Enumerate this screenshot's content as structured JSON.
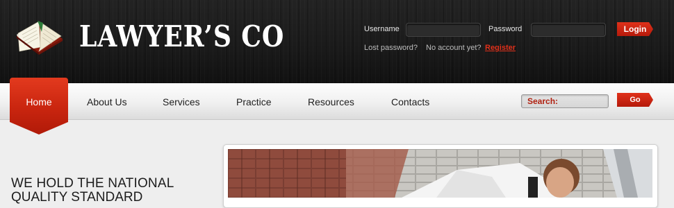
{
  "brand": {
    "name": "LAWYER’S CO",
    "logo_icon": "open-book-icon"
  },
  "login": {
    "username_label": "Username",
    "password_label": "Password",
    "login_button": "Login",
    "lost_password": "Lost password?",
    "no_account": "No account yet?",
    "register_link": "Register"
  },
  "nav": {
    "items": [
      "Home",
      "About Us",
      "Services",
      "Practice",
      "Resources",
      "Contacts"
    ],
    "active": "Home"
  },
  "search": {
    "label": "Search:",
    "button": "Go"
  },
  "main": {
    "headline_line1": "WE HOLD THE NATIONAL",
    "headline_line2": "QUALITY STANDARD",
    "photo_icon": "businessman-on-phone-photo"
  },
  "colors": {
    "accent": "#c9250f",
    "header_bg": "#1c1c1c",
    "nav_bg": "#f0f0f0"
  }
}
